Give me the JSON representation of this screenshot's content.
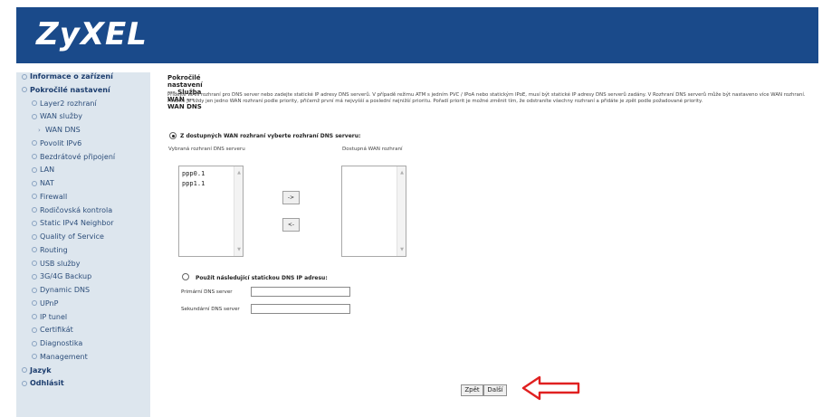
{
  "brand": {
    "logo": "ZyXEL",
    "header_color": "#1a4a8a",
    "sidebar_color": "#dde6ee"
  },
  "nav": [
    {
      "label": "Informace o zařízení",
      "level": 0,
      "bold": true
    },
    {
      "label": "Pokročilé nastavení",
      "level": 0,
      "bold": true
    },
    {
      "label": "Layer2 rozhraní",
      "level": 1
    },
    {
      "label": "WAN služby",
      "level": 1
    },
    {
      "label": "WAN DNS",
      "level": 2,
      "active": true
    },
    {
      "label": "Povolit IPv6",
      "level": 1
    },
    {
      "label": "Bezdrátové připojení",
      "level": 1
    },
    {
      "label": "LAN",
      "level": 1
    },
    {
      "label": "NAT",
      "level": 1
    },
    {
      "label": "Firewall",
      "level": 1
    },
    {
      "label": "Rodičovská kontrola",
      "level": 1
    },
    {
      "label": "Static IPv4 Neighbor",
      "level": 1
    },
    {
      "label": "Quality of Service",
      "level": 1
    },
    {
      "label": "Routing",
      "level": 1
    },
    {
      "label": "USB služby",
      "level": 1
    },
    {
      "label": "3G/4G Backup",
      "level": 1
    },
    {
      "label": "Dynamic DNS",
      "level": 1
    },
    {
      "label": "UPnP",
      "level": 1
    },
    {
      "label": "IP tunel",
      "level": 1
    },
    {
      "label": "Certifikát",
      "level": 1
    },
    {
      "label": "Diagnostika",
      "level": 1
    },
    {
      "label": "Management",
      "level": 1
    },
    {
      "label": "Jazyk",
      "level": 0,
      "bold": true
    },
    {
      "label": "Odhlásit",
      "level": 0,
      "bold": true
    }
  ],
  "main": {
    "title": "Pokročilé nastavení --- Služba WAN --- WAN DNS",
    "description": "Přidejte WAN rozhraní pro DNS server nebo zadejte statické IP adresy DNS serverů. V případě režimu ATM s jedním PVC / IPoA nebo statickým IPoE, musí být statické IP adresy DNS serverů zadány. V Rozhraní DNS serverů může být nastaveno více WAN rozhraní. Použité je vždy jen jedno WAN rozhraní podle priority, přičemž první má nejvyšší a poslední nejnižší prioritu. Pořadí priorit je možné změnit tím, že odstraníte všechny rozhraní a přidáte je zpět podle požadované priority.",
    "option_available": "Z dostupných WAN rozhraní vyberte rozhraní DNS serveru:",
    "selected_label": "Vybraná rozhraní DNS serveru",
    "available_label": "Dostupná WAN rozhraní",
    "selected_items": [
      "ppp0.1",
      "ppp1.1"
    ],
    "available_items": [],
    "move_right": "->",
    "move_left": "<-",
    "option_static": "Použít následující statickou DNS IP adresu:",
    "primary_label": "Primární DNS server",
    "secondary_label": "Sekundární DNS server",
    "primary_value": "",
    "secondary_value": "",
    "back_button": "Zpět",
    "next_button": "Další",
    "annotation_arrow_color": "#e02020"
  }
}
